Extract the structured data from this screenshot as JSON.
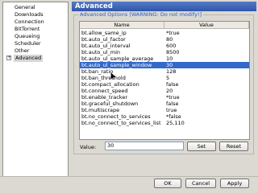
{
  "tree": {
    "items": [
      {
        "label": "General"
      },
      {
        "label": "Downloads"
      },
      {
        "label": "Connection"
      },
      {
        "label": "BitTorrent"
      },
      {
        "label": "Queueing"
      },
      {
        "label": "Scheduler"
      },
      {
        "label": "Other"
      },
      {
        "label": "Advanced",
        "selected": true,
        "expander": "+"
      }
    ]
  },
  "panel": {
    "title": "Advanced",
    "group_title": "Advanced Options [WARNING: Do not modify!]",
    "columns": {
      "name": "Name",
      "value": "Value"
    },
    "rows": [
      {
        "name": "bt.allow_same_ip",
        "value": "*true"
      },
      {
        "name": "bt.auto_ul_factor",
        "value": "80"
      },
      {
        "name": "bt.auto_ul_interval",
        "value": "600"
      },
      {
        "name": "bt.auto_ul_min",
        "value": "8500"
      },
      {
        "name": "bt.auto_ul_sample_average",
        "value": "10"
      },
      {
        "name": "bt.auto_ul_sample_window",
        "value": "30",
        "selected": true
      },
      {
        "name": "bt.ban_ratio",
        "value": "128"
      },
      {
        "name": "bt.ban_threshold",
        "value": "5"
      },
      {
        "name": "bt.compact_allocation",
        "value": "false"
      },
      {
        "name": "bt.connect_speed",
        "value": "20"
      },
      {
        "name": "bt.enable_tracker",
        "value": "*true"
      },
      {
        "name": "bt.graceful_shutdown",
        "value": "false"
      },
      {
        "name": "bt.multiscrape",
        "value": "true"
      },
      {
        "name": "bt.no_connect_to_services",
        "value": "*false"
      },
      {
        "name": "bt.no_connect_to_services_list",
        "value": "25,110"
      }
    ],
    "value_label": "Value:",
    "value_input": "30",
    "set_label": "Set",
    "reset_label": "Reset"
  },
  "footer": {
    "ok_label": "OK",
    "cancel_label": "Cancel",
    "apply_label": "Apply"
  },
  "colors": {
    "header_bg": "#3b63b8",
    "selection_bg": "#3369c9",
    "group_title": "#2d5cc8"
  }
}
